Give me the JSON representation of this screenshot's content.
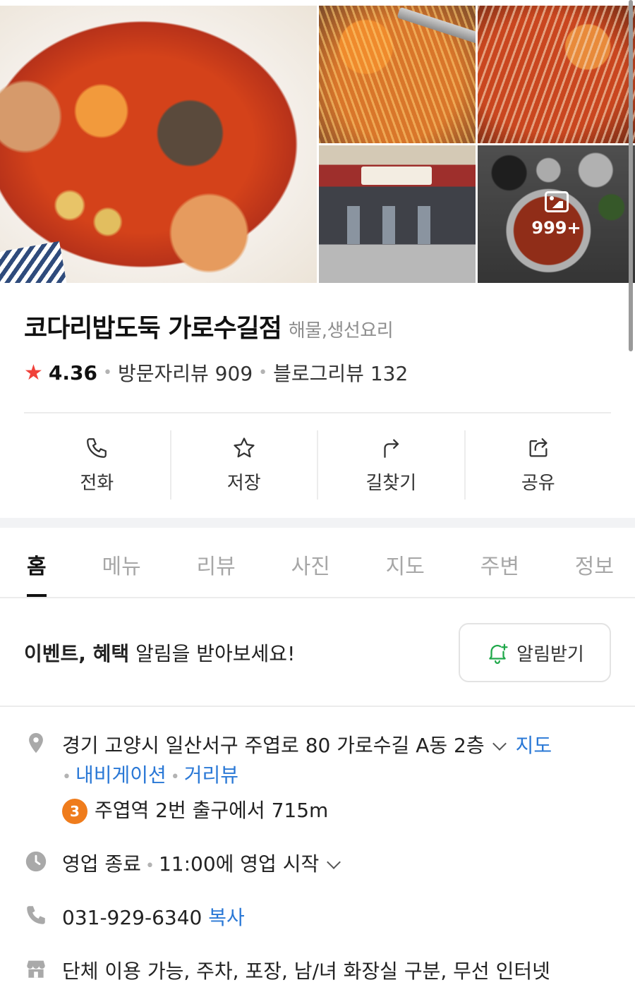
{
  "photos": {
    "more_count": "999+"
  },
  "place": {
    "name": "코다리밥도둑 가로수길점",
    "category": "해물,생선요리"
  },
  "rating": {
    "star": "★",
    "score": "4.36",
    "visitor_reviews": "방문자리뷰 909",
    "blog_reviews": "블로그리뷰 132"
  },
  "actions": [
    {
      "label": "전화",
      "icon": "phone-icon"
    },
    {
      "label": "저장",
      "icon": "star-icon"
    },
    {
      "label": "길찾기",
      "icon": "directions-icon"
    },
    {
      "label": "공유",
      "icon": "share-icon"
    }
  ],
  "tabs": [
    "홈",
    "메뉴",
    "리뷰",
    "사진",
    "지도",
    "주변",
    "정보"
  ],
  "notice": {
    "bold": "이벤트, 혜택",
    "text": " 알림을 받아보세요!",
    "button": "알림받기"
  },
  "info": {
    "address": "경기 고양시 일산서구 주엽로 80 가로수길 A동 2층",
    "map_link": "지도",
    "navigation_link": "내비게이션",
    "street_view_link": "거리뷰",
    "subway_line": "3",
    "subway_text": "주엽역 2번 출구에서 715m",
    "hours_status": "영업 종료",
    "hours_next": "11:00에 영업 시작",
    "phone": "031-929-6340",
    "copy_label": "복사",
    "facilities": "단체 이용 가능, 주차, 포장, 남/녀 화장실 구분, 무선 인터넷"
  },
  "colors": {
    "accent_blue": "#2a78d6",
    "star_red": "#f0413a",
    "subway_line3": "#ef7c1c"
  }
}
